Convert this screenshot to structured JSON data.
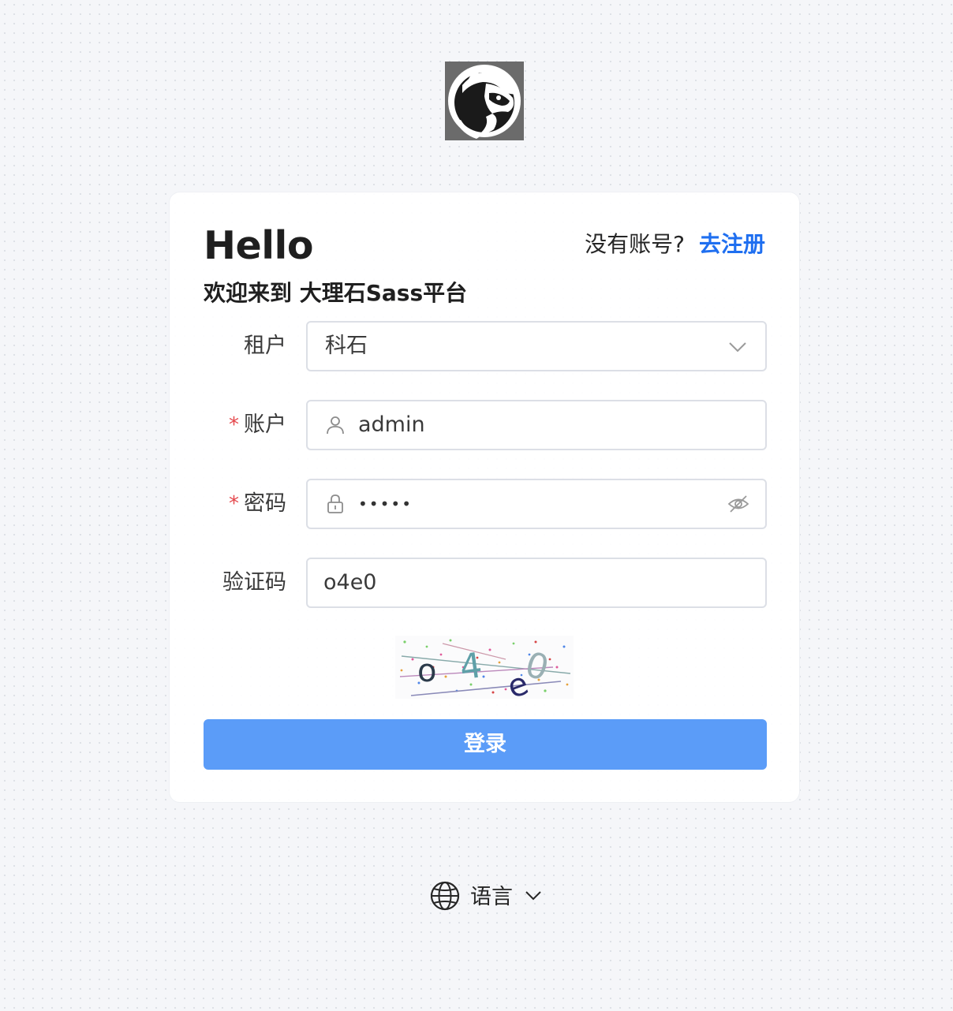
{
  "brand": {
    "logo_icon": "badger-head-icon"
  },
  "header": {
    "title": "Hello",
    "welcome": "欢迎来到 大理石Sass平台",
    "register_prompt": "没有账号?",
    "register_link": "去注册"
  },
  "form": {
    "tenant": {
      "label": "租户",
      "value": "科石",
      "icon": "chevron-down-icon"
    },
    "account": {
      "label": "账户",
      "required_mark": "*",
      "value": "admin",
      "icon": "user-icon"
    },
    "password": {
      "label": "密码",
      "required_mark": "*",
      "value": "•••••",
      "icon": "lock-icon",
      "toggle_icon": "eye-off-icon"
    },
    "captcha": {
      "label": "验证码",
      "value": "o4e0",
      "image_text": "o4e0"
    },
    "submit_label": "登录"
  },
  "footer": {
    "language_label": "语言",
    "language_icon": "globe-icon"
  },
  "colors": {
    "primary_button": "#5b9cf8",
    "link": "#1f6ff0",
    "required": "#e5484d",
    "border": "#dcdfe6"
  }
}
